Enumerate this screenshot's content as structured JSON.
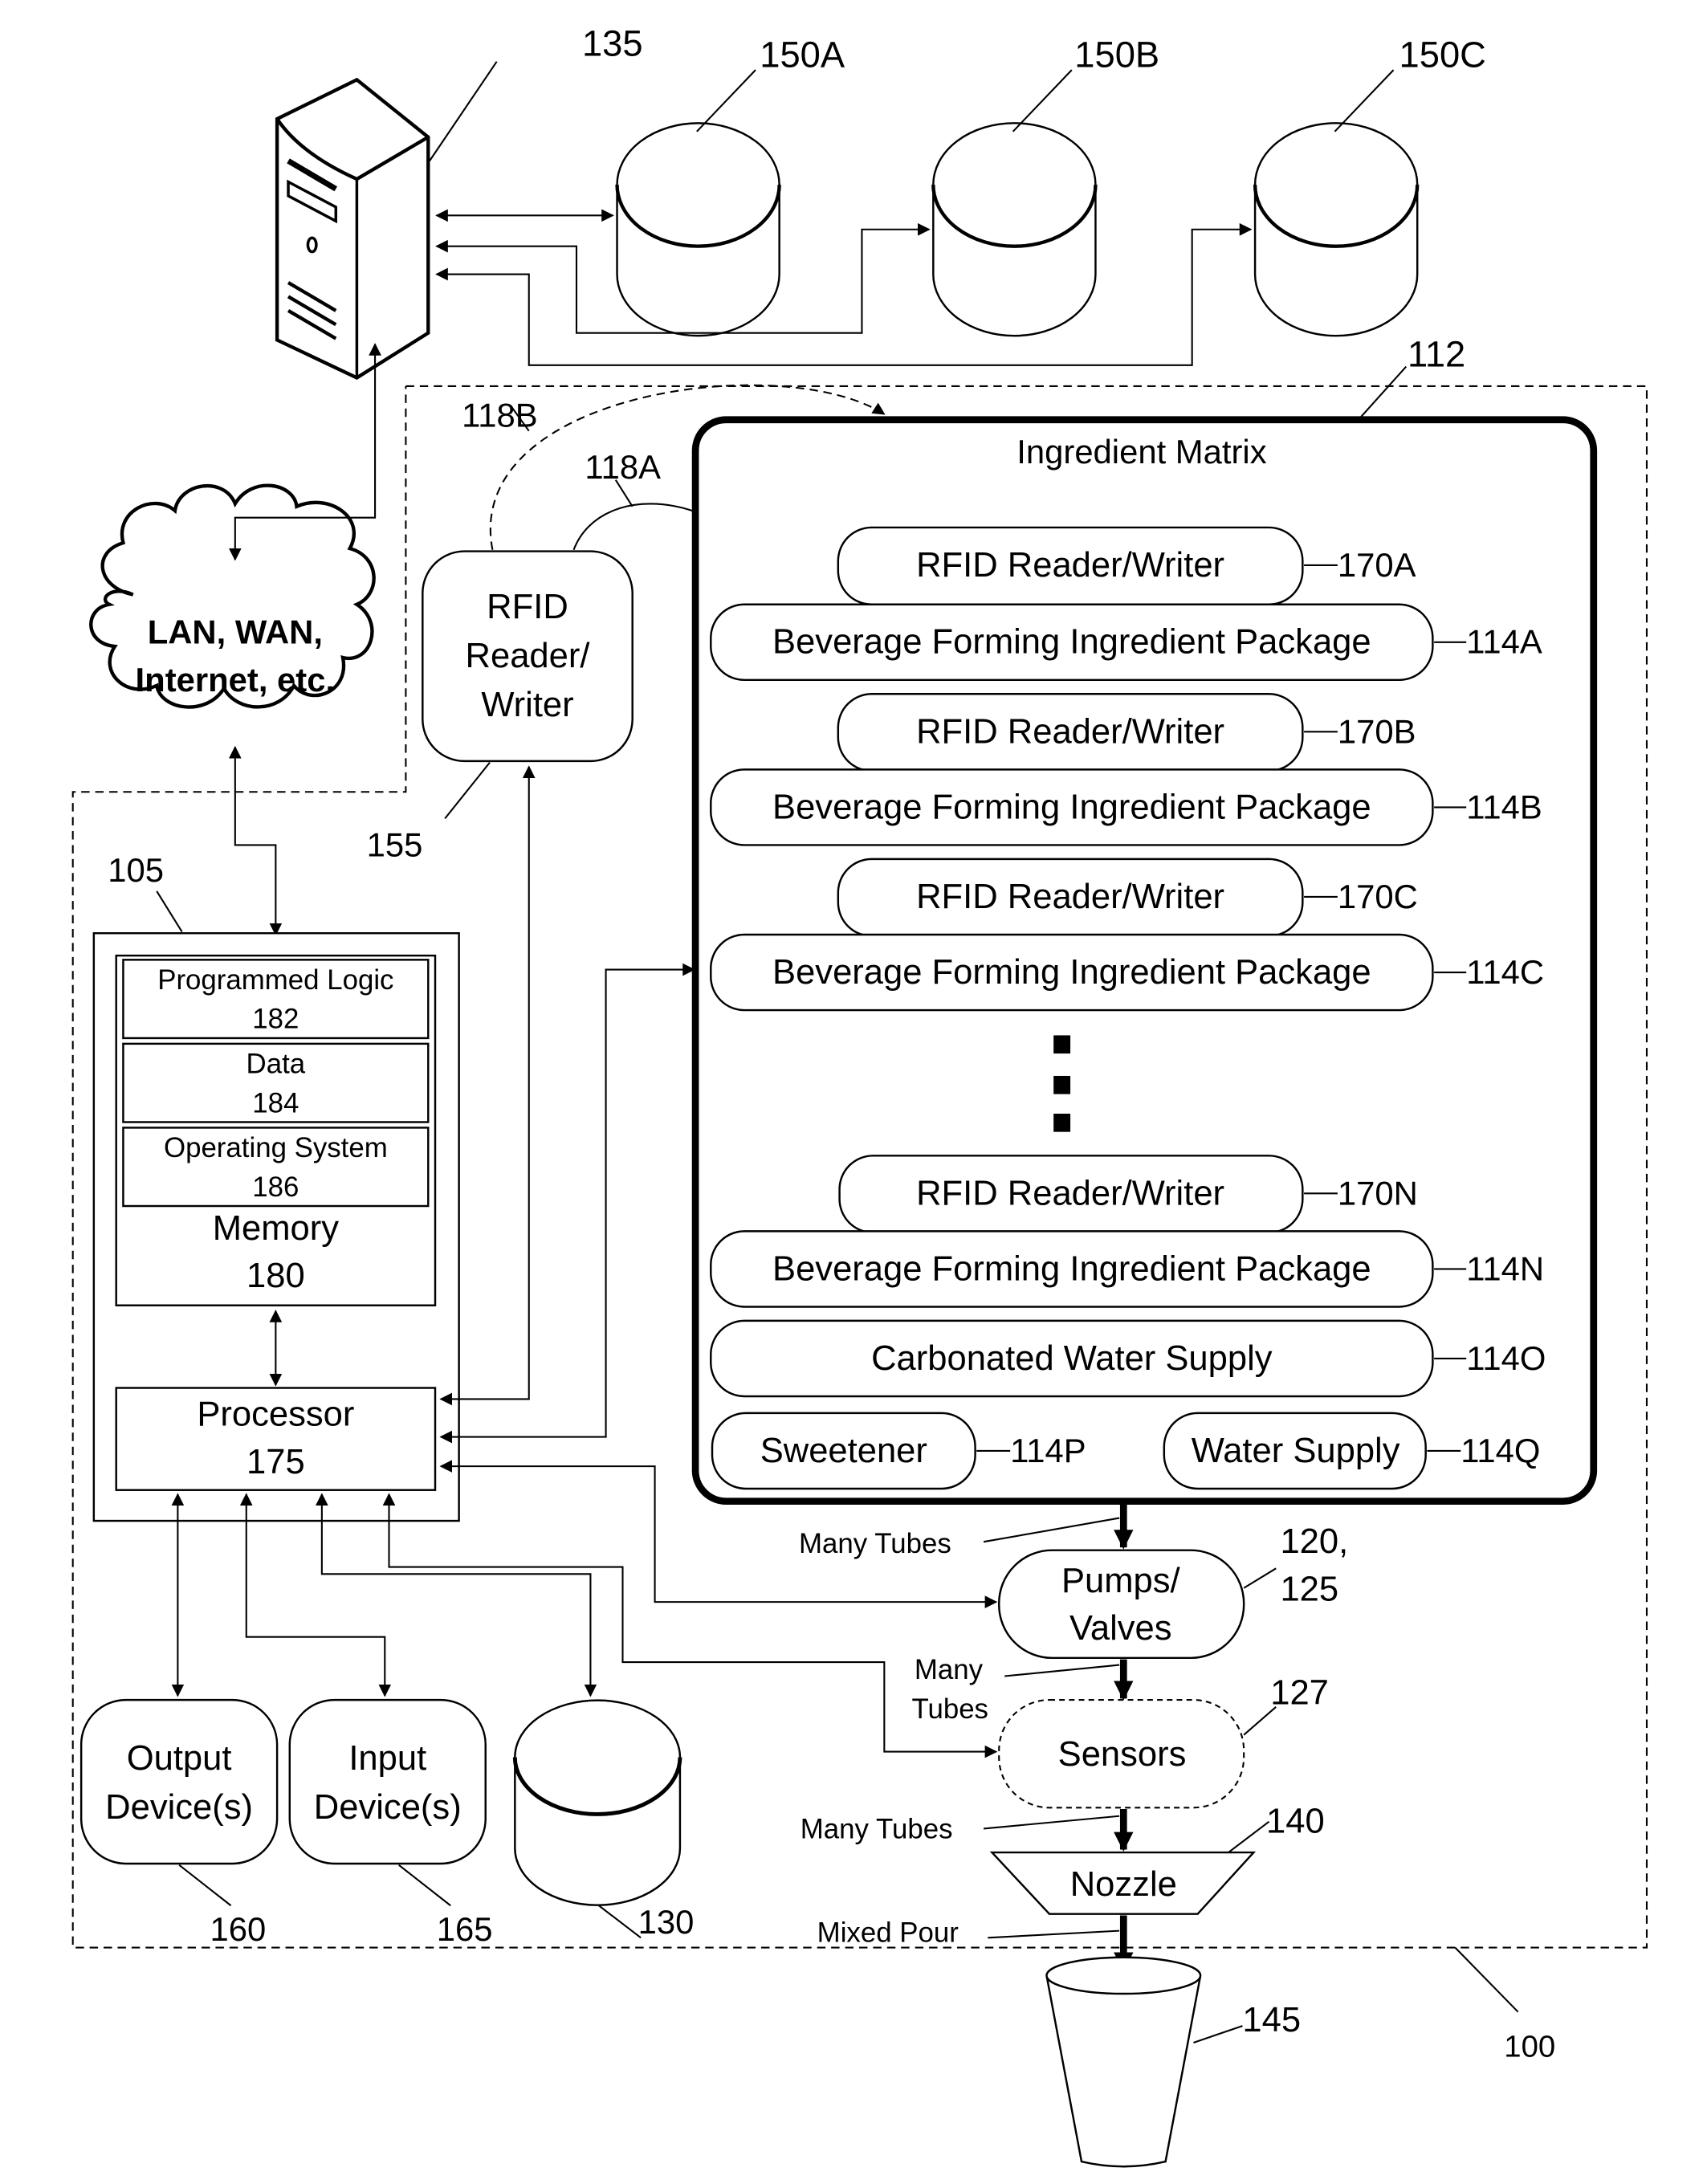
{
  "figure": {
    "system_label": "100",
    "server": {
      "label": "135"
    },
    "databases": [
      {
        "label": "150A"
      },
      {
        "label": "150B"
      },
      {
        "label": "150C"
      }
    ],
    "network": {
      "line1": "LAN, WAN,",
      "line2": "Internet, etc."
    },
    "rfid_main": {
      "line1": "RFID",
      "line2": "Reader/",
      "line3": "Writer",
      "ref": "155"
    },
    "links": {
      "a": "118A",
      "b": "118B"
    },
    "controller": {
      "ref": "105",
      "memory": {
        "blocks": [
          {
            "name": "Programmed Logic",
            "ref": "182"
          },
          {
            "name": "Data",
            "ref": "184"
          },
          {
            "name": "Operating System",
            "ref": "186"
          }
        ],
        "title": "Memory",
        "ref": "180"
      },
      "processor": {
        "title": "Processor",
        "ref": "175"
      }
    },
    "matrix": {
      "title": "Ingredient Matrix",
      "ref": "112",
      "rows": [
        {
          "reader": "RFID Reader/Writer",
          "reader_ref": "170A",
          "package": "Beverage Forming Ingredient Package",
          "package_ref": "114A"
        },
        {
          "reader": "RFID Reader/Writer",
          "reader_ref": "170B",
          "package": "Beverage Forming Ingredient Package",
          "package_ref": "114B"
        },
        {
          "reader": "RFID Reader/Writer",
          "reader_ref": "170C",
          "package": "Beverage Forming Ingredient Package",
          "package_ref": "114C"
        },
        {
          "reader": "RFID Reader/Writer",
          "reader_ref": "170N",
          "package": "Beverage Forming Ingredient Package",
          "package_ref": "114N"
        }
      ],
      "carbonated": {
        "label": "Carbonated Water Supply",
        "ref": "114O"
      },
      "sweetener": {
        "label": "Sweetener",
        "ref": "114P"
      },
      "water": {
        "label": "Water Supply",
        "ref": "114Q"
      }
    },
    "flow": {
      "tubes1": "Many Tubes",
      "pumps": {
        "line1": "Pumps/",
        "line2": "Valves",
        "ref1": "120,",
        "ref2": "125"
      },
      "tubes2_line1": "Many",
      "tubes2_line2": "Tubes",
      "sensors": {
        "label": "Sensors",
        "ref": "127"
      },
      "tubes3": "Many Tubes",
      "nozzle": {
        "label": "Nozzle",
        "ref": "140"
      },
      "pour": "Mixed Pour",
      "cup": {
        "ref": "145"
      }
    },
    "devices": {
      "output": {
        "line1": "Output",
        "line2": "Device(s)",
        "ref": "160"
      },
      "input": {
        "line1": "Input",
        "line2": "Device(s)",
        "ref": "165"
      },
      "storage": {
        "ref": "130"
      }
    }
  }
}
